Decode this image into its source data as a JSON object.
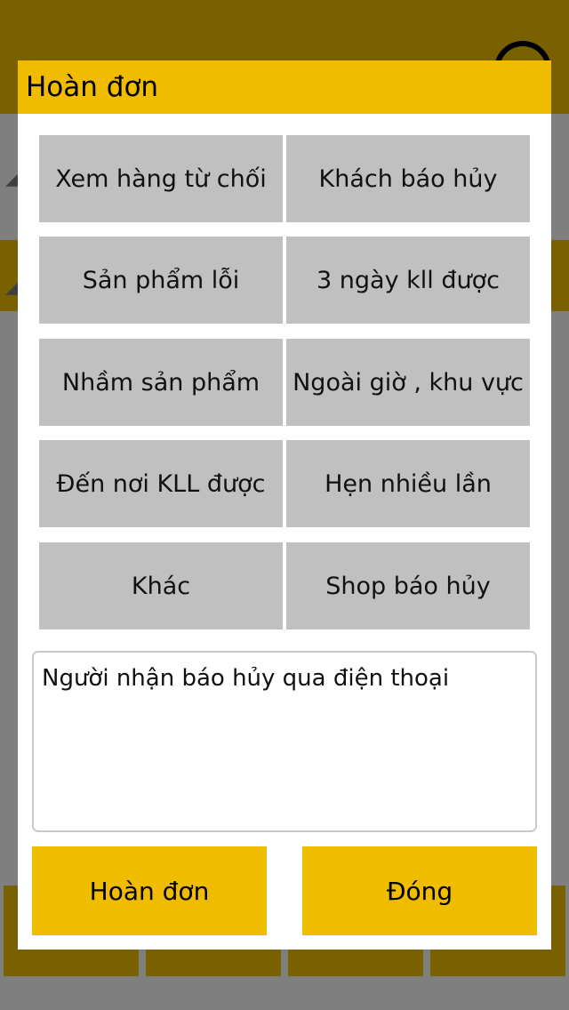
{
  "dialog": {
    "title": "Hoàn đơn",
    "reasons": [
      "Xem hàng từ chối",
      "Khách báo hủy",
      "Sản phẩm lỗi",
      "3 ngày kll được",
      "Nhầm sản phẩm",
      "Ngoài giờ , khu vực",
      "Đến nơi KLL được",
      "Hẹn nhiều lần",
      "Khác",
      "Shop báo hủy"
    ],
    "note_value": "Người nhận báo hủy qua điện thoại",
    "confirm_label": "Hoàn đơn",
    "close_label": "Đóng"
  },
  "colors": {
    "accent": "#f0bc00",
    "button_gray": "#c0c0c0",
    "overlay_header": "#796000"
  },
  "icons": {
    "profile": "profile-icon"
  }
}
